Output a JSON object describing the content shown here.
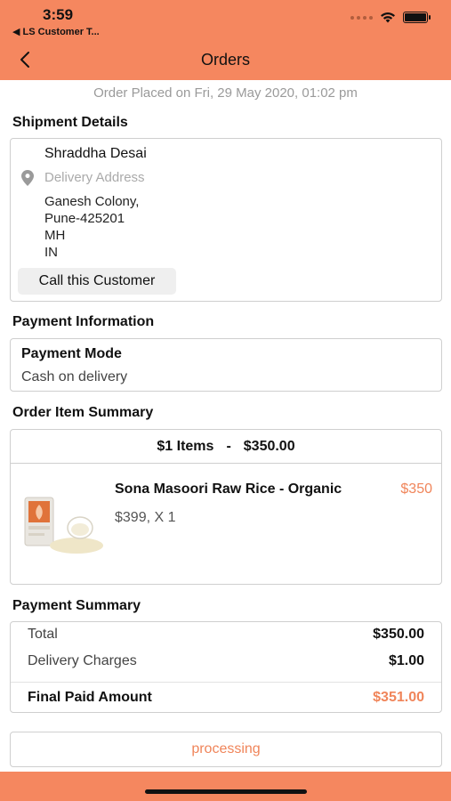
{
  "status_bar": {
    "time": "3:59",
    "back_app": "◀ LS Customer T..."
  },
  "nav": {
    "title": "Orders",
    "back_icon": "chevron-left-icon"
  },
  "order_placed": "Order Placed on Fri, 29 May 2020, 01:02 pm",
  "shipment": {
    "section_title": "Shipment Details",
    "customer_name": "Shraddha Desai",
    "address_label": "Delivery Address",
    "address_lines": [
      "Ganesh Colony,",
      "Pune-425201",
      "MH",
      "IN"
    ],
    "call_button": "Call this Customer"
  },
  "payment": {
    "section_title": "Payment Information",
    "mode_label": "Payment Mode",
    "mode_value": "Cash on delivery"
  },
  "order_items": {
    "section_title": "Order Item Summary",
    "count": "$1 Items",
    "separator": "-",
    "total": "$350.00",
    "items": [
      {
        "name": "Sona Masoori Raw Rice - Organic",
        "price": "$350",
        "unit_qty": "$399, X 1"
      }
    ]
  },
  "payment_summary": {
    "section_title": "Payment Summary",
    "total_label": "Total",
    "total_value": "$350.00",
    "delivery_label": "Delivery Charges",
    "delivery_value": "$1.00",
    "final_label": "Final Paid Amount",
    "final_value": "$351.00"
  },
  "order_status": "processing",
  "colors": {
    "accent": "#f5875f",
    "price_accent": "#f0855a",
    "border": "#cfcfcf"
  }
}
